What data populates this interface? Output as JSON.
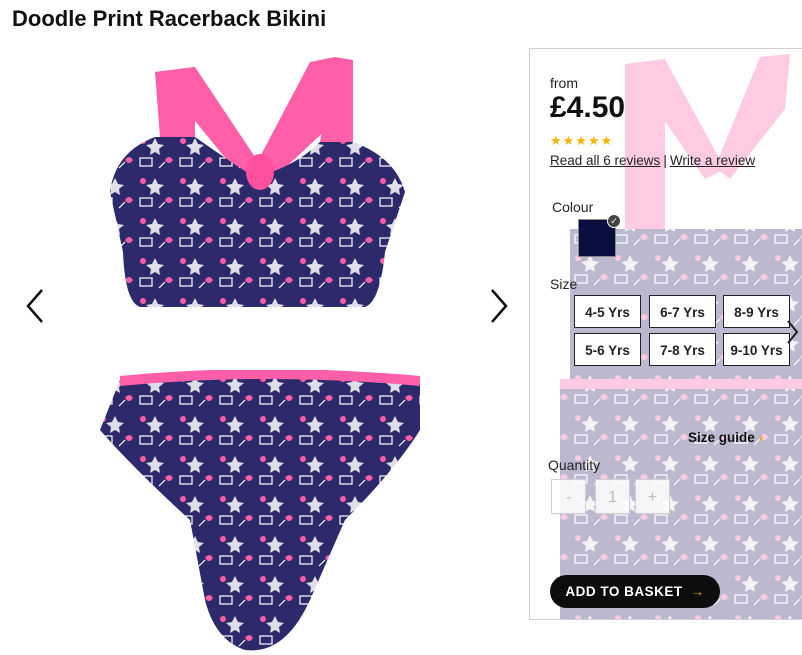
{
  "product": {
    "title": "Doodle Print Racerback Bikini"
  },
  "gallery": {
    "prev_icon": "chevron-left-icon",
    "next_icon": "chevron-right-icon"
  },
  "details": {
    "price_prefix": "from",
    "price": "£4.50",
    "rating_stars": "★★★★★",
    "rating": 5,
    "reviews_link": "Read all 6 reviews",
    "separator": "|",
    "write_review_link": "Write a review",
    "colour_label": "Colour",
    "colour_selected": "#0a0e3f",
    "size_label": "Size",
    "sizes": [
      "4-5 Yrs",
      "6-7 Yrs",
      "8-9 Yrs",
      "5-6 Yrs",
      "7-8 Yrs",
      "9-10 Yrs"
    ],
    "size_guide": "Size guide",
    "quantity_label": "Quantity",
    "qty_minus": "-",
    "qty_value": "1",
    "qty_plus": "+",
    "add_to_basket": "ADD TO BASKET"
  },
  "colors": {
    "navy": "#2c2a6b",
    "pink": "#ff5fa8",
    "accent": "#f0a500",
    "star": "#f2b600"
  }
}
